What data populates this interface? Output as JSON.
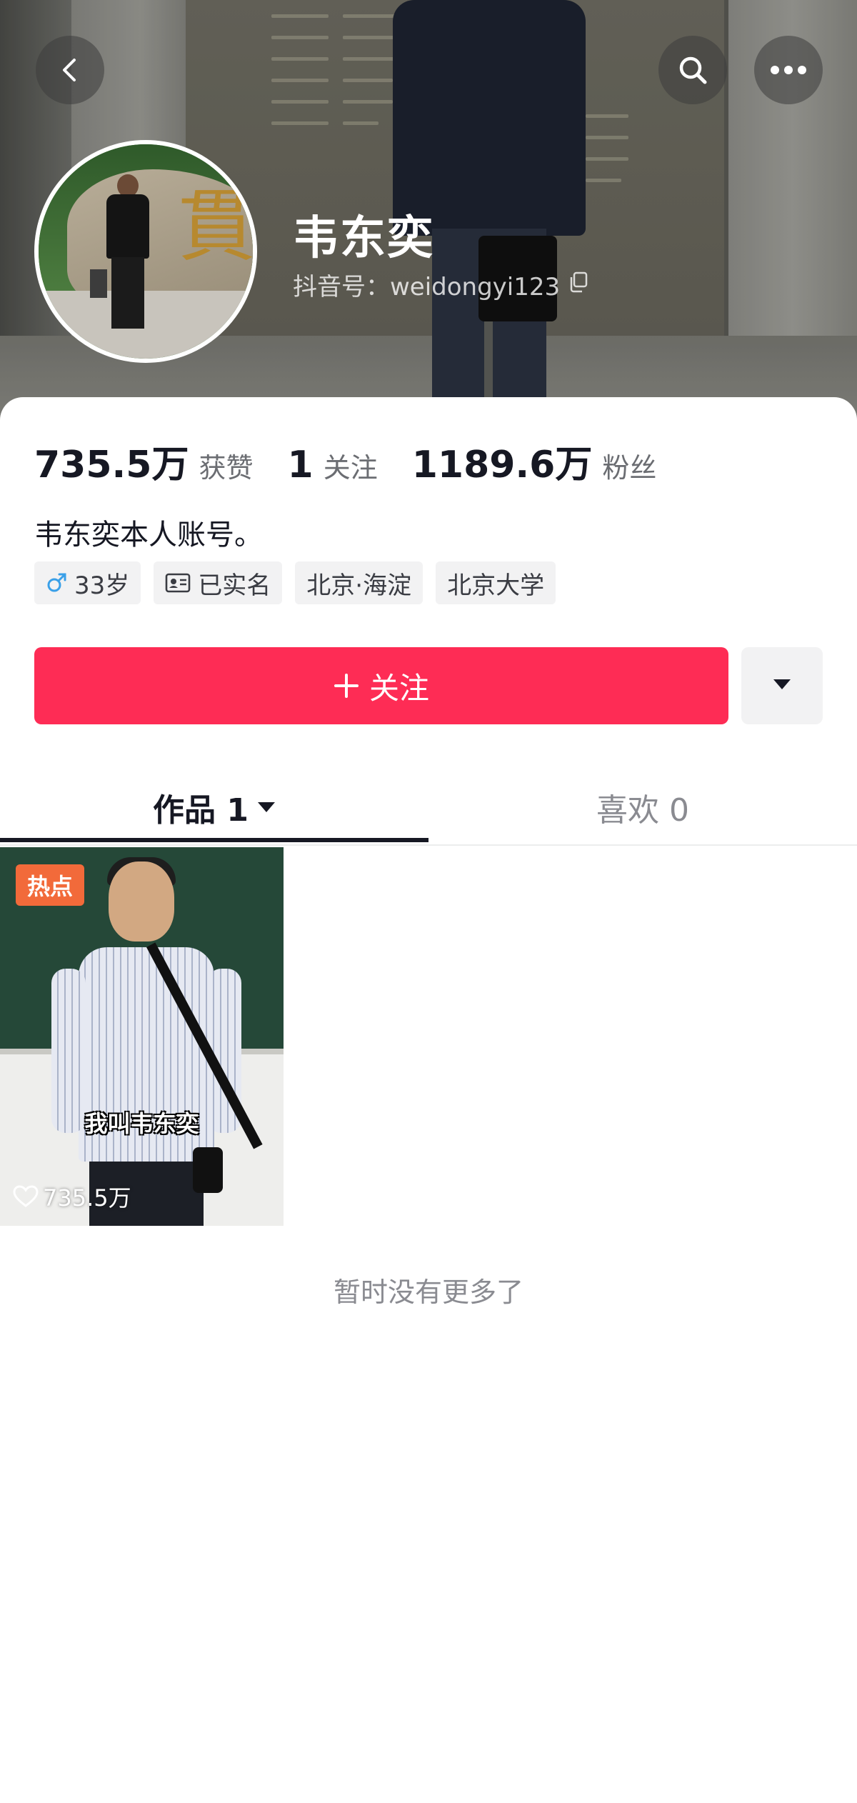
{
  "header": {
    "name": "韦东奕",
    "handle_label": "抖音号：weidongyi123",
    "back_icon": "chevron-left-icon",
    "search_icon": "search-icon",
    "more_icon": "more-horizontal-icon"
  },
  "stats": [
    {
      "value": "735.5万",
      "label": "获赞"
    },
    {
      "value": "1",
      "label": "关注"
    },
    {
      "value": "1189.6万",
      "label": "粉丝"
    }
  ],
  "bio": "韦东奕本人账号。",
  "tags": [
    {
      "icon": "male-icon",
      "label": "33岁"
    },
    {
      "icon": "id-card-icon",
      "label": "已实名"
    },
    {
      "label": "北京·海淀"
    },
    {
      "label": "北京大学"
    }
  ],
  "follow_button": {
    "label": "关注",
    "icon": "plus-icon",
    "color": "#fe2c55"
  },
  "more_button": {
    "icon": "caret-down-icon"
  },
  "tabs": [
    {
      "label": "作品 1",
      "active": true
    },
    {
      "label": "喜欢 0",
      "active": false
    }
  ],
  "videos": [
    {
      "badge": "热点",
      "caption": "我叫韦东奕",
      "likes": "735.5万"
    }
  ],
  "footer_text": "暂时没有更多了",
  "colors": {
    "accent": "#fe2c55",
    "text": "#161823",
    "muted": "#8a8b91",
    "hot_badge": "#f26a3a"
  }
}
